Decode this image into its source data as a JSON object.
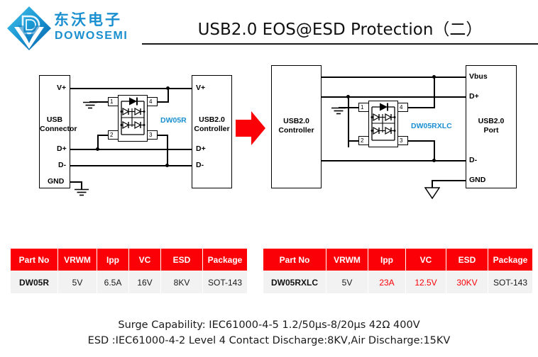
{
  "header": {
    "logo_cn": "东沃电子",
    "logo_en": "DOWOSEMI",
    "logo_mark": "dowosemi-diamond-logo",
    "title": "USB2.0 EOS@ESD Protection（二）",
    "brand_color": "#1a8fd0",
    "accent_color": "#fb0007"
  },
  "left_circuit": {
    "source_block": {
      "line1": "USB",
      "line2": "Connector"
    },
    "dest_block": {
      "line1": "USB2.0",
      "line2": "Controller"
    },
    "part_name": "DW05R",
    "source_pins": [
      "V+",
      "D+",
      "D-",
      "GND"
    ],
    "dest_pins": [
      "V+",
      "D+",
      "D-"
    ],
    "device_pins": [
      "1",
      "2",
      "3",
      "4"
    ]
  },
  "arrow": {
    "name": "red-right-arrow",
    "color": "#fb0007"
  },
  "right_circuit": {
    "source_block": {
      "line1": "USB2.0",
      "line2": "Controller"
    },
    "dest_block": {
      "line1": "USB2.0",
      "line2": "Port"
    },
    "part_name": "DW05RXLC",
    "dest_pins": [
      "Vbus",
      "D+",
      "D-",
      "GND"
    ],
    "device_pins": [
      "1",
      "2",
      "3",
      "4"
    ]
  },
  "table_left": {
    "columns": [
      "Part No",
      "VRWM",
      "Ipp",
      "VC",
      "ESD",
      "Package"
    ],
    "rows": [
      {
        "cells": [
          "DW05R",
          "5V",
          "6.5A",
          "16V",
          "8KV",
          "SOT-143"
        ],
        "highlight": [
          false,
          false,
          false,
          false,
          false,
          false
        ]
      }
    ]
  },
  "table_right": {
    "columns": [
      "Part No",
      "VRWM",
      "Ipp",
      "VC",
      "ESD",
      "Package"
    ],
    "rows": [
      {
        "cells": [
          "DW05RXLC",
          "5V",
          "23A",
          "12.5V",
          "30KV",
          "SOT-143"
        ],
        "highlight": [
          false,
          false,
          true,
          true,
          true,
          false
        ]
      }
    ]
  },
  "footer": {
    "line1": "Surge Capability:   IEC61000-4-5 1.2/50μs-8/20μs  42Ω   400V",
    "line2": "ESD :IEC61000-4-2 Level 4 Contact Discharge:8KV,Air Discharge:15KV"
  }
}
